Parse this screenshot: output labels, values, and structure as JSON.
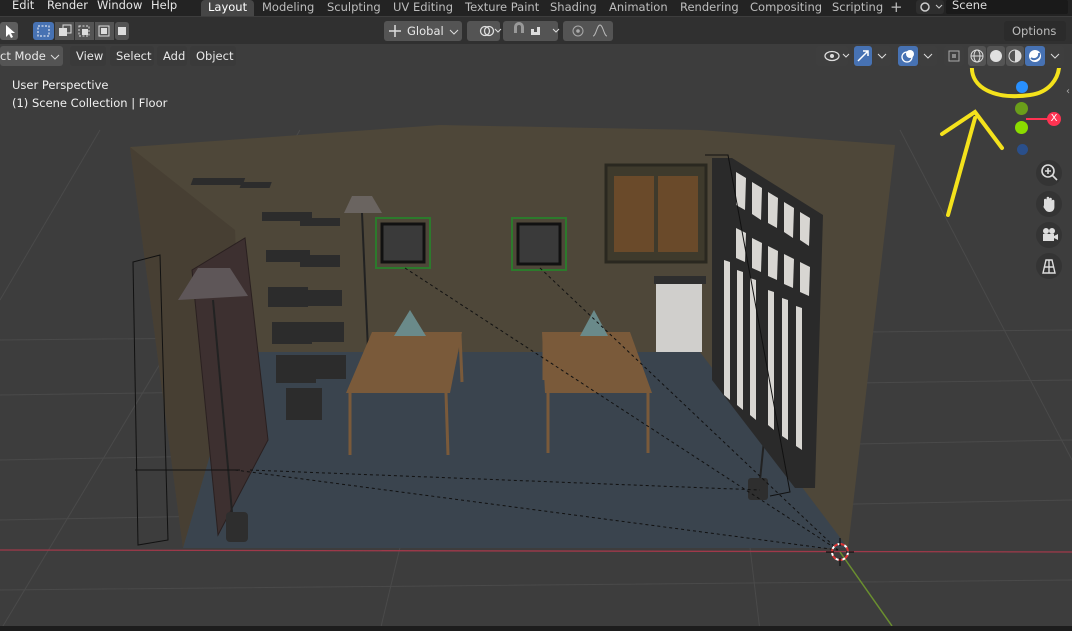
{
  "menu": {
    "edit": "Edit",
    "render": "Render",
    "window": "Window",
    "help": "Help"
  },
  "workspaces": [
    "Layout",
    "Modeling",
    "Sculpting",
    "UV Editing",
    "Texture Paint",
    "Shading",
    "Animation",
    "Rendering",
    "Compositing",
    "Scripting"
  ],
  "scene_name": "Scene",
  "options_label": "Options",
  "transform_orientation": "Global",
  "header": {
    "mode": "ct Mode",
    "view": "View",
    "select": "Select",
    "add": "Add",
    "object": "Object"
  },
  "viewport": {
    "perspective": "User Perspective",
    "collection": "(1) Scene Collection | Floor"
  },
  "gizmo": {
    "x": "X",
    "y": "Y",
    "z": "Z"
  },
  "colors": {
    "annotation": "#f4e21c",
    "axis_x": "#ff3352",
    "axis_y": "#8bdc00",
    "axis_z": "#2890ff",
    "active_tab": "#464646",
    "selected": "#4772b3"
  },
  "shading_modes": [
    "wireframe",
    "solid",
    "material-preview",
    "rendered"
  ],
  "active_shading": "rendered"
}
